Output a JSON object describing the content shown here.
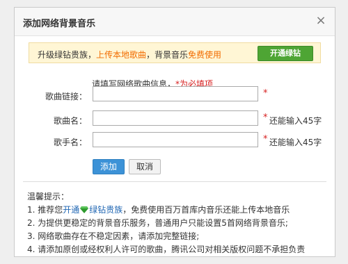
{
  "dialog": {
    "title": "添加网络背景音乐",
    "close_glyph": "×"
  },
  "notice": {
    "part1": "升级绿钻贵族，",
    "part2": "上传本地歌曲",
    "part3": "，背景音乐",
    "part4": "免费使用",
    "button_label": "开通绿钻"
  },
  "form": {
    "hint_text": "请填写网络歌曲信息，",
    "hint_required": "*为必填项",
    "fields": [
      {
        "label": "歌曲链接：",
        "value": "",
        "star": "*",
        "remain": ""
      },
      {
        "label": "歌曲名：",
        "value": "",
        "star": "*",
        "remain": "还能输入45字"
      },
      {
        "label": "歌手名：",
        "value": "",
        "star": "*",
        "remain": "还能输入45字"
      }
    ],
    "add_label": "添加",
    "cancel_label": "取消"
  },
  "tips": {
    "title": "温馨提示：",
    "line1_prefix": "1. 推荐您",
    "line1_link1": "开通",
    "line1_link2": "绿钻贵族",
    "line1_suffix": "，免费使用百万首库内音乐还能上传本地音乐",
    "line2": "2. 为提供更稳定的背景音乐服务，普通用户只能设置5首网络背景音乐;",
    "line3": "3. 网络歌曲存在不稳定因素，请添加完整链接;",
    "line4": "4. 请添加原创或经权利人许可的歌曲，腾讯公司对相关版权问题不承担负责"
  },
  "colors": {
    "accent_orange": "#f26c00",
    "button_green": "#4ea534",
    "button_blue": "#3c92d7",
    "required_red": "#d71f1f",
    "link_blue": "#1f66b3",
    "diamond_green": "#2e9a2e"
  }
}
